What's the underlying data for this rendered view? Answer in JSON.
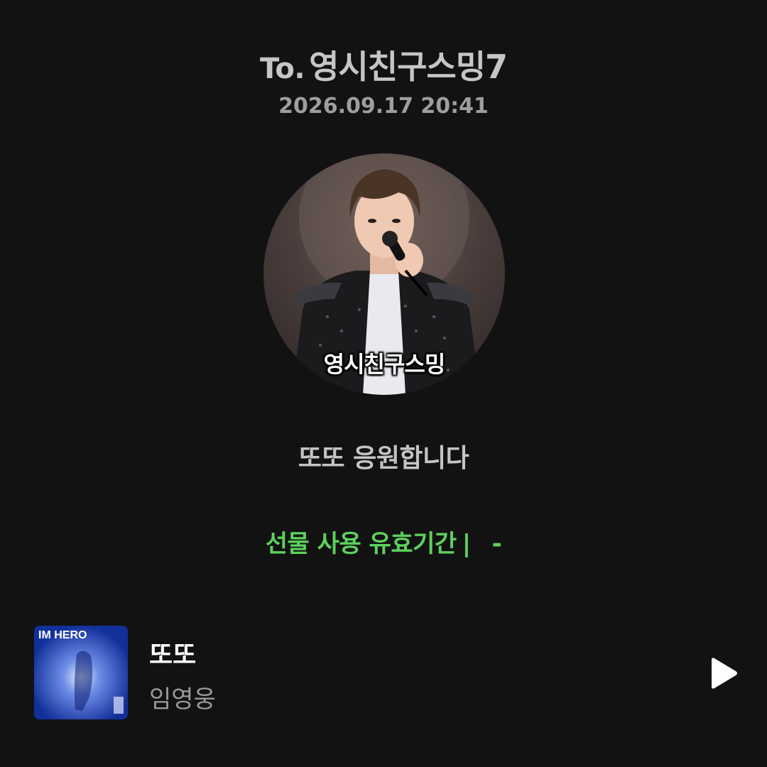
{
  "header": {
    "prefix": "To.",
    "recipient": "영시친구스밍7",
    "timestamp": "2026.09.17 20:41"
  },
  "avatar": {
    "caption": "영시친구스밍"
  },
  "message": "또또 응원합니다",
  "validity": {
    "label": "선물 사용 유효기간",
    "separator": "|",
    "value": "-"
  },
  "track": {
    "title": "또또",
    "artist": "임영웅",
    "album_art_text": "IM HERO"
  },
  "colors": {
    "background": "#121212",
    "accent_green": "#5dd15d",
    "text_primary": "#ffffff",
    "text_secondary": "#9a9a9a"
  },
  "icons": {
    "play": "play-icon"
  }
}
